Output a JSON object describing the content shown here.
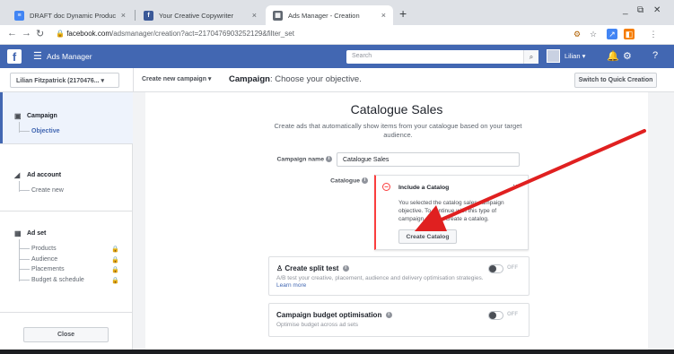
{
  "browser": {
    "tabs": [
      {
        "title": "DRAFT doc Dynamic Product Ad",
        "icon": "docs-icon"
      },
      {
        "title": "Your Creative Copywriter",
        "icon": "facebook-icon"
      },
      {
        "title": "Ads Manager - Creation",
        "icon": "ads-manager-icon"
      }
    ],
    "new_tab": "+",
    "url_host": "facebook.com",
    "url_path": "/adsmanager/creation?act=2170476903252129&filter_set"
  },
  "header": {
    "app_title": "Ads Manager",
    "search_placeholder": "Search",
    "user_name": "Lilian"
  },
  "subheader": {
    "account": "Lilian Fitzpatrick (2170476...",
    "create_campaign": "Create new campaign",
    "crumb_bold": "Campaign",
    "crumb_rest": ": Choose your objective.",
    "quick_creation": "Switch to Quick Creation"
  },
  "sidebar": {
    "campaign": {
      "label": "Campaign",
      "items": [
        "Objective"
      ]
    },
    "ad_account": {
      "label": "Ad account",
      "items": [
        "Create new"
      ]
    },
    "ad_set": {
      "label": "Ad set",
      "items": [
        "Products",
        "Audience",
        "Placements",
        "Budget & schedule"
      ]
    },
    "close": "Close"
  },
  "main": {
    "title": "Catalogue Sales",
    "description": "Create ads that automatically show items from your catalogue based on your target audience.",
    "campaign_name_label": "Campaign name",
    "campaign_name_value": "Catalogue Sales",
    "catalogue_label": "Catalogue",
    "catalog_box": {
      "title": "Include a Catalog",
      "message": "You selected the catalog sales campaign objective. To continue with this type of campaign, please create a catalog.",
      "button": "Create Catalog",
      "more": "···"
    },
    "split_test": {
      "title": "Create split test",
      "desc": "A/B test your creative, placement, audience and delivery optimisation strategies.",
      "link": "Learn more",
      "state": "OFF"
    },
    "budget_opt": {
      "title": "Campaign budget optimisation",
      "desc": "Optimise budget across ad sets",
      "state": "OFF"
    }
  },
  "colors": {
    "brand": "#4267b2",
    "error": "#fa3e3e",
    "annotation_arrow": "#e02020"
  }
}
